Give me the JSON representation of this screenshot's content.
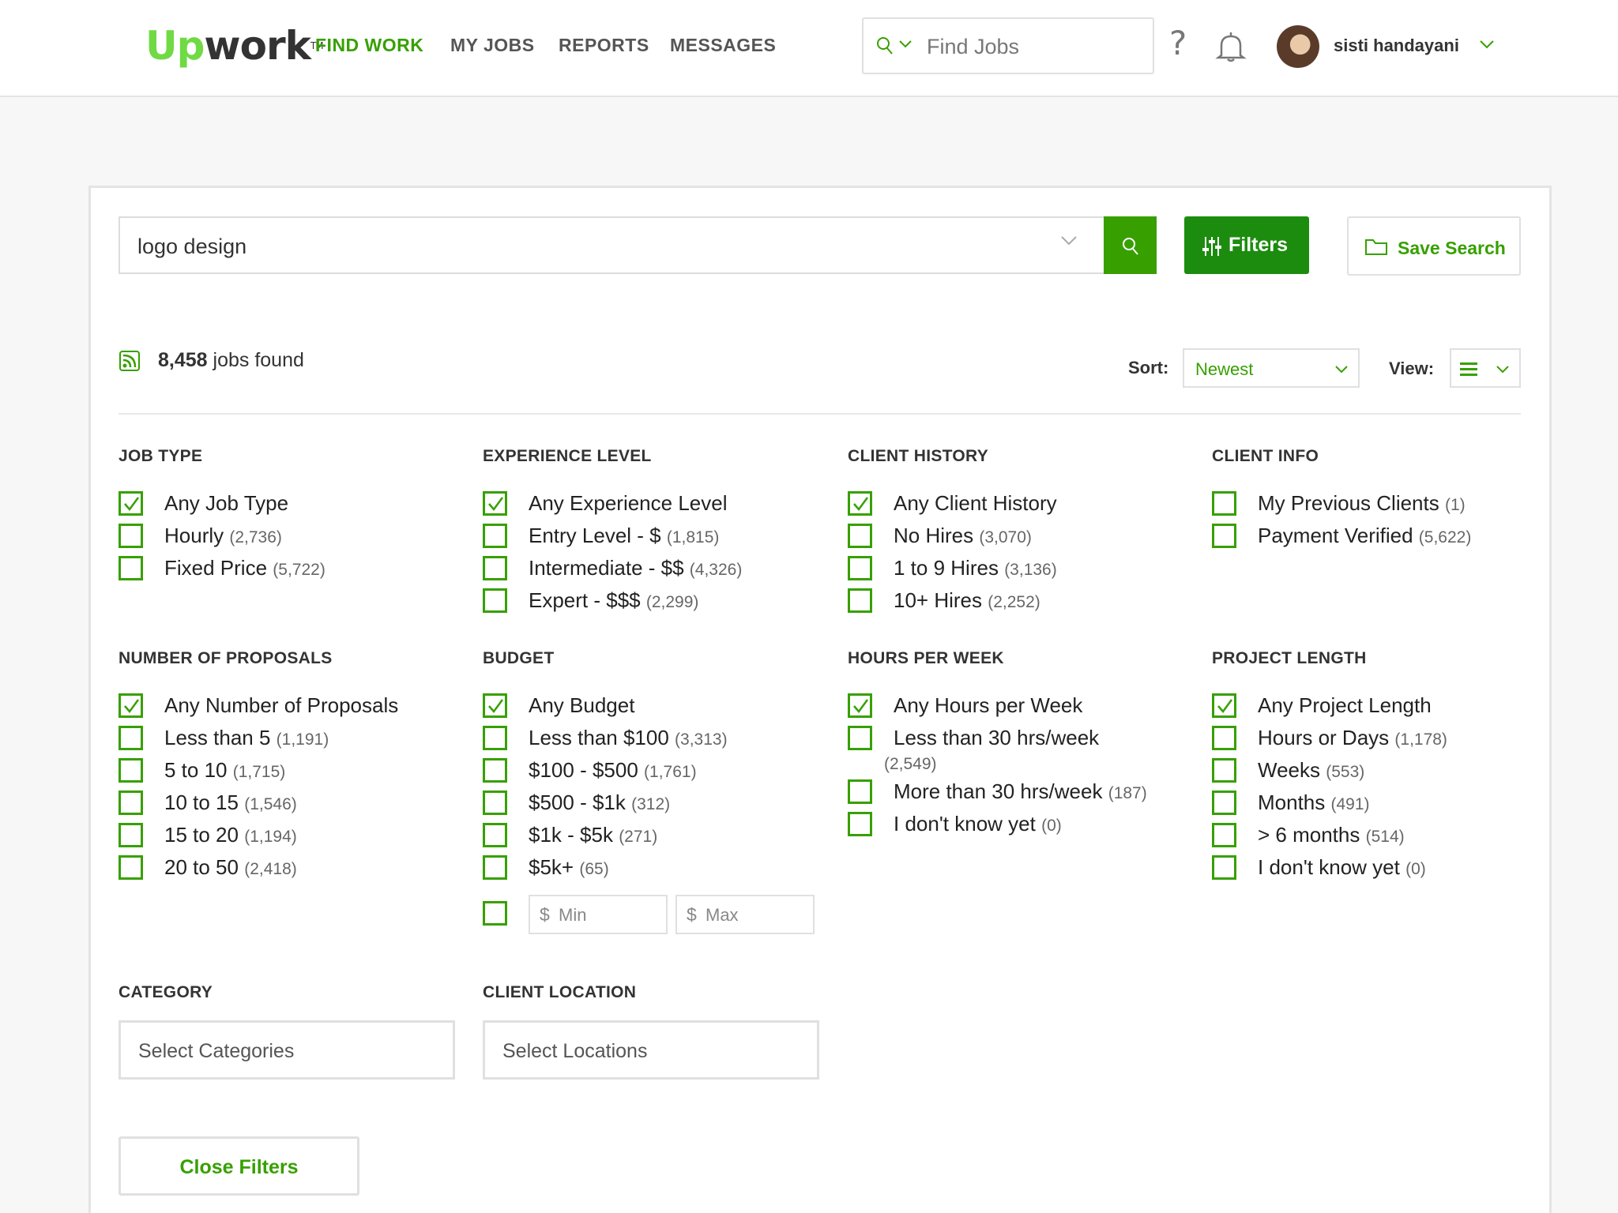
{
  "header": {
    "logo": {
      "up": "Up",
      "work": "work",
      "tm": "TM"
    },
    "nav": [
      {
        "label": "FIND WORK",
        "active": true
      },
      {
        "label": "MY JOBS",
        "active": false
      },
      {
        "label": "REPORTS",
        "active": false
      },
      {
        "label": "MESSAGES",
        "active": false
      }
    ],
    "search_placeholder": "Find Jobs",
    "help": "?",
    "username": "sisti handayani"
  },
  "search": {
    "query": "logo design",
    "filters_label": "Filters",
    "save_label": "Save Search"
  },
  "results": {
    "count": "8,458",
    "suffix": " jobs found",
    "sort_label": "Sort:",
    "sort_value": "Newest",
    "view_label": "View:"
  },
  "groups": {
    "job_type": {
      "title": "JOB TYPE",
      "options": [
        {
          "label": "Any Job Type",
          "count": "",
          "checked": true
        },
        {
          "label": "Hourly",
          "count": "(2,736)",
          "checked": false
        },
        {
          "label": "Fixed Price",
          "count": "(5,722)",
          "checked": false
        }
      ]
    },
    "experience": {
      "title": "EXPERIENCE LEVEL",
      "options": [
        {
          "label": "Any Experience Level",
          "count": "",
          "checked": true
        },
        {
          "label": "Entry Level - $",
          "count": "(1,815)",
          "checked": false
        },
        {
          "label": "Intermediate - $$",
          "count": "(4,326)",
          "checked": false
        },
        {
          "label": "Expert - $$$",
          "count": "(2,299)",
          "checked": false
        }
      ]
    },
    "client_history": {
      "title": "CLIENT HISTORY",
      "options": [
        {
          "label": "Any Client History",
          "count": "",
          "checked": true
        },
        {
          "label": "No Hires",
          "count": "(3,070)",
          "checked": false
        },
        {
          "label": "1 to 9 Hires",
          "count": "(3,136)",
          "checked": false
        },
        {
          "label": "10+ Hires",
          "count": "(2,252)",
          "checked": false
        }
      ]
    },
    "client_info": {
      "title": "CLIENT INFO",
      "options": [
        {
          "label": "My Previous Clients",
          "count": "(1)",
          "checked": false
        },
        {
          "label": "Payment Verified",
          "count": "(5,622)",
          "checked": false
        }
      ]
    },
    "proposals": {
      "title": "NUMBER OF PROPOSALS",
      "options": [
        {
          "label": "Any Number of Proposals",
          "count": "",
          "checked": true
        },
        {
          "label": "Less than 5",
          "count": "(1,191)",
          "checked": false
        },
        {
          "label": "5 to 10",
          "count": "(1,715)",
          "checked": false
        },
        {
          "label": "10 to 15",
          "count": "(1,546)",
          "checked": false
        },
        {
          "label": "15 to 20",
          "count": "(1,194)",
          "checked": false
        },
        {
          "label": "20 to 50",
          "count": "(2,418)",
          "checked": false
        }
      ]
    },
    "budget": {
      "title": "BUDGET",
      "options": [
        {
          "label": "Any Budget",
          "count": "",
          "checked": true
        },
        {
          "label": "Less than $100",
          "count": "(3,313)",
          "checked": false
        },
        {
          "label": "$100 - $500",
          "count": "(1,761)",
          "checked": false
        },
        {
          "label": "$500 - $1k",
          "count": "(312)",
          "checked": false
        },
        {
          "label": "$1k - $5k",
          "count": "(271)",
          "checked": false
        },
        {
          "label": "$5k+",
          "count": "(65)",
          "checked": false
        }
      ],
      "currency": "$",
      "min_placeholder": "Min",
      "max_placeholder": "Max"
    },
    "hours": {
      "title": "HOURS PER WEEK",
      "options": [
        {
          "label": "Any Hours per Week",
          "count": "",
          "checked": true
        },
        {
          "label": "Less than 30 hrs/week",
          "count": "(2,549)",
          "checked": false
        },
        {
          "label": "More than 30 hrs/week",
          "count": "(187)",
          "checked": false
        },
        {
          "label": "I don't know yet",
          "count": "(0)",
          "checked": false
        }
      ]
    },
    "project_length": {
      "title": "PROJECT LENGTH",
      "options": [
        {
          "label": "Any Project Length",
          "count": "",
          "checked": true
        },
        {
          "label": "Hours or Days",
          "count": "(1,178)",
          "checked": false
        },
        {
          "label": "Weeks",
          "count": "(553)",
          "checked": false
        },
        {
          "label": "Months",
          "count": "(491)",
          "checked": false
        },
        {
          "label": "> 6 months",
          "count": "(514)",
          "checked": false
        },
        {
          "label": "I don't know yet",
          "count": "(0)",
          "checked": false
        }
      ]
    }
  },
  "category": {
    "title": "CATEGORY",
    "placeholder": "Select Categories"
  },
  "location": {
    "title": "CLIENT LOCATION",
    "placeholder": "Select Locations"
  },
  "close_label": "Close Filters",
  "colors": {
    "brand": "#37a000",
    "brand_dark": "#1c8c0f",
    "logo_green": "#6fda44"
  }
}
